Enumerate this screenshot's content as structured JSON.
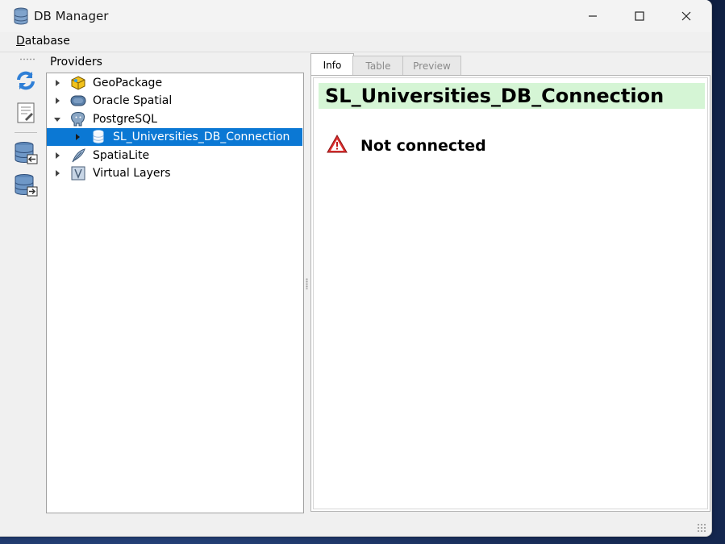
{
  "window": {
    "title": "DB Manager",
    "controls": {
      "minimize": "minimize-icon",
      "maximize": "maximize-icon",
      "close": "close-icon"
    }
  },
  "menu": {
    "database_label": "Database",
    "database_mnemonic": "D"
  },
  "toolbar": {
    "buttons": [
      "refresh-icon",
      "sql-window-icon",
      "import-layer-icon",
      "export-file-icon"
    ]
  },
  "providers": {
    "label": "Providers",
    "items": [
      {
        "label": "GeoPackage",
        "icon": "geopackage-icon",
        "expanded": false
      },
      {
        "label": "Oracle Spatial",
        "icon": "oracle-icon",
        "expanded": false
      },
      {
        "label": "PostgreSQL",
        "icon": "postgresql-icon",
        "expanded": true,
        "children": [
          {
            "label": "SL_Universities_DB_Connection",
            "icon": "database-icon",
            "selected": true
          }
        ]
      },
      {
        "label": "SpatiaLite",
        "icon": "spatialite-icon",
        "expanded": false
      },
      {
        "label": "Virtual Layers",
        "icon": "virtual-layers-icon",
        "expanded": false
      }
    ]
  },
  "tabs": [
    {
      "label": "Info",
      "active": true
    },
    {
      "label": "Table",
      "active": false
    },
    {
      "label": "Preview",
      "active": false
    }
  ],
  "info": {
    "connection_title": "SL_Universities_DB_Connection",
    "status": "Not connected",
    "title_bg": "#d5f5d5"
  },
  "colors": {
    "selection": "#0b78d4",
    "warning": "#d42020"
  }
}
